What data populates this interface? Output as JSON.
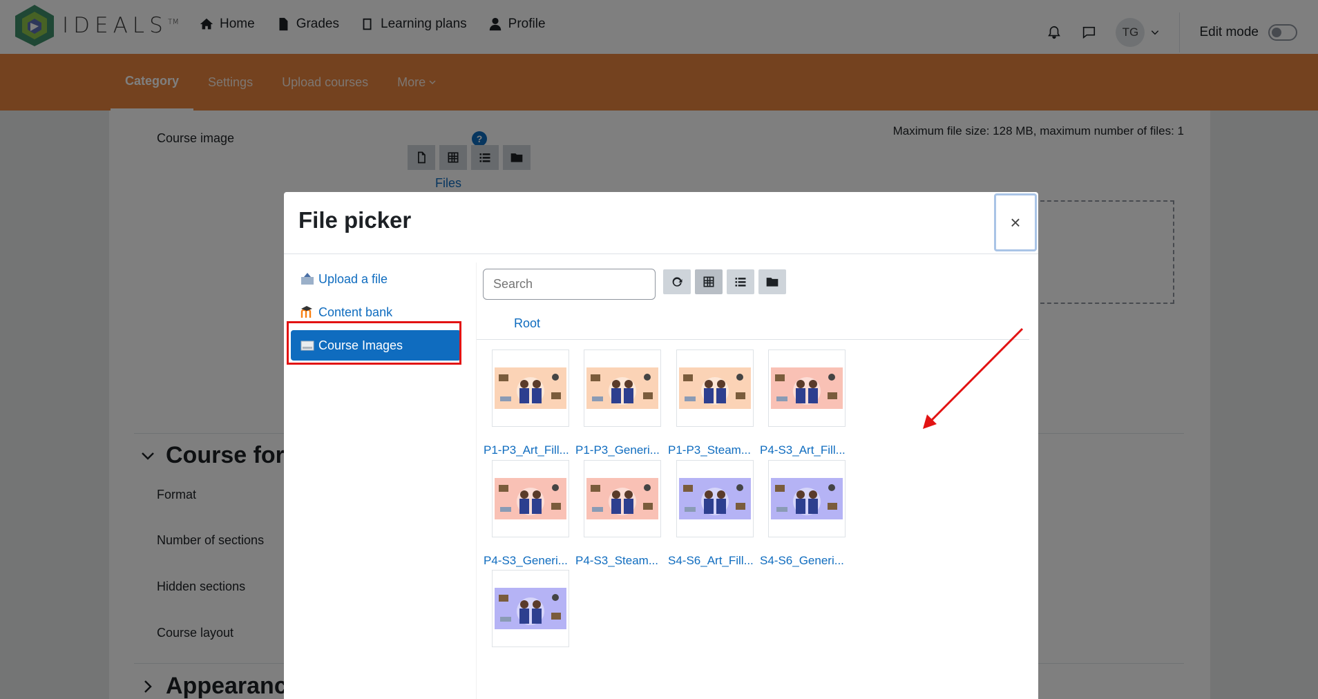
{
  "navbar": {
    "logo_text": "IDEALS",
    "logo_tm": "TM",
    "links": [
      {
        "label": "Home",
        "icon": "home-icon"
      },
      {
        "label": "Grades",
        "icon": "file-icon"
      },
      {
        "label": "Learning plans",
        "icon": "book-icon"
      },
      {
        "label": "Profile",
        "icon": "user-icon"
      }
    ],
    "avatar_initials": "TG",
    "edit_mode_label": "Edit mode"
  },
  "subnav": {
    "tabs": [
      {
        "label": "Category",
        "active": true
      },
      {
        "label": "Settings"
      },
      {
        "label": "Upload courses"
      },
      {
        "label": "More"
      }
    ]
  },
  "page": {
    "course_image_label": "Course image",
    "max_file_info": "Maximum file size: 128 MB, maximum number of files: 1",
    "files_label": "Files",
    "course_format_title": "Course format",
    "format_label": "Format",
    "sections_label": "Number of sections",
    "hidden_label": "Hidden sections",
    "layout_label": "Course layout",
    "appearance_title": "Appearance"
  },
  "modal": {
    "title": "File picker",
    "close_symbol": "×",
    "repositories": [
      {
        "label": "Upload a file",
        "icon": "upload-icon"
      },
      {
        "label": "Content bank",
        "icon": "moodle-icon"
      },
      {
        "label": "Course Images",
        "icon": "image-folder-icon",
        "selected": true
      }
    ],
    "search_placeholder": "Search",
    "breadcrumb_root": "Root",
    "files": [
      {
        "name": "P1-P3_Art_Fill...",
        "bg": "#fbd3b6"
      },
      {
        "name": "P1-P3_Generi...",
        "bg": "#fbd3b6"
      },
      {
        "name": "P1-P3_Steam...",
        "bg": "#fbd3b6"
      },
      {
        "name": "P4-S3_Art_Fill...",
        "bg": "#f9c1b5"
      },
      {
        "name": "P4-S3_Generi...",
        "bg": "#f9c1b5"
      },
      {
        "name": "P4-S3_Steam...",
        "bg": "#f9c1b5"
      },
      {
        "name": "S4-S6_Art_Fill...",
        "bg": "#b5b3f5"
      },
      {
        "name": "S4-S6_Generi...",
        "bg": "#b5b3f5"
      },
      {
        "name": "",
        "bg": "#b5b3f5"
      }
    ]
  },
  "colors": {
    "accent": "#0f6cbf",
    "subnav": "#e9853f",
    "highlight": "#e21313"
  }
}
